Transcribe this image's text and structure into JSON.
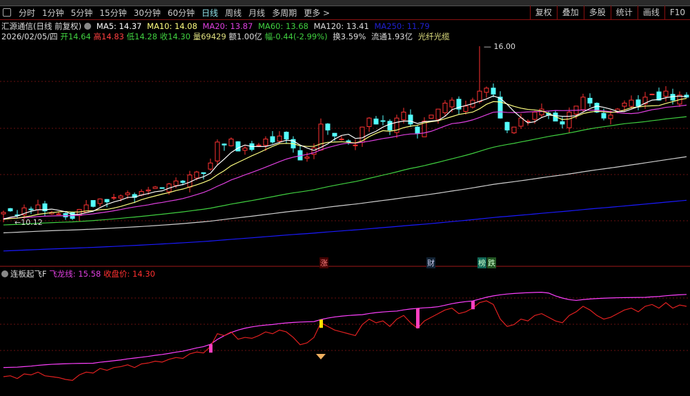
{
  "toolbar": {
    "periods": [
      "分时",
      "1分钟",
      "5分钟",
      "15分钟",
      "30分钟",
      "60分钟",
      "日线",
      "周线",
      "月线",
      "多周期",
      "更多 >"
    ],
    "active": "日线",
    "right": [
      "复权",
      "叠加",
      "多股",
      "统计",
      "画线",
      "F10"
    ]
  },
  "stock": {
    "title": "汇源通信(日线 前复权)",
    "ma": {
      "ma5": "MA5: 14.37",
      "ma10": "MA10: 14.08",
      "ma20": "MA20: 13.87",
      "ma60": "MA60: 13.68",
      "ma120": "MA120: 13.41",
      "ma250": "MA250: 11.79"
    },
    "date": "2026/02/05/四",
    "open": "开14.64",
    "high": "高14.83",
    "low": "低14.28",
    "close": "收14.30",
    "volume": "量69429",
    "amount": "额1.00亿",
    "change": "幅-0.44(-2.99%)",
    "turnover": "换3.59%",
    "float": "流通1.93亿",
    "sector": "光纤光缆"
  },
  "annotations": {
    "max_label": "16.00",
    "min_label": "10.12"
  },
  "signals": {
    "zhang": "涨",
    "cai": "财",
    "bang": "榜",
    "die": "跌"
  },
  "indicator": {
    "name": "连板起飞F",
    "feilong": "飞龙线: 15.58",
    "close": "收盘价: 14.30"
  },
  "colors": {
    "up": "#ff3232",
    "down": "#54ffff",
    "ma5": "#ffffff",
    "ma10": "#ffff80",
    "ma20": "#e040e0",
    "ma60": "#40d040",
    "ma120": "#d0d0d0",
    "ma250": "#1a1aff",
    "feilong": "#ff40ff",
    "closeline": "#e02020"
  },
  "chart_data": {
    "type": "candlestick",
    "closes": [
      10.45,
      10.5,
      10.35,
      10.6,
      10.55,
      10.7,
      10.5,
      10.45,
      10.4,
      10.3,
      10.25,
      10.55,
      10.7,
      10.65,
      10.9,
      10.8,
      10.95,
      11.0,
      11.1,
      10.95,
      11.15,
      11.2,
      11.3,
      11.25,
      11.4,
      11.5,
      11.45,
      11.7,
      11.8,
      11.75,
      12.1,
      12.8,
      12.7,
      12.9,
      12.5,
      12.6,
      12.55,
      12.7,
      12.9,
      12.8,
      13.0,
      12.9,
      12.6,
      12.2,
      12.3,
      12.6,
      13.4,
      13.2,
      13.0,
      12.9,
      12.8,
      12.7,
      13.3,
      13.6,
      13.4,
      13.5,
      13.2,
      13.6,
      13.8,
      13.4,
      13.1,
      13.5,
      13.7,
      13.9,
      14.1,
      14.2,
      13.9,
      14.0,
      14.2,
      14.5,
      14.6,
      14.4,
      13.6,
      13.2,
      13.3,
      13.6,
      13.5,
      13.8,
      13.9,
      13.7,
      13.5,
      13.4,
      13.8,
      14.0,
      14.3,
      14.1,
      13.8,
      13.6,
      13.7,
      13.9,
      14.1,
      14.2,
      14.0,
      14.3,
      14.4,
      14.2,
      14.5,
      14.2,
      14.37,
      14.3
    ],
    "ymax": 16.0,
    "ymin": 10.12
  }
}
